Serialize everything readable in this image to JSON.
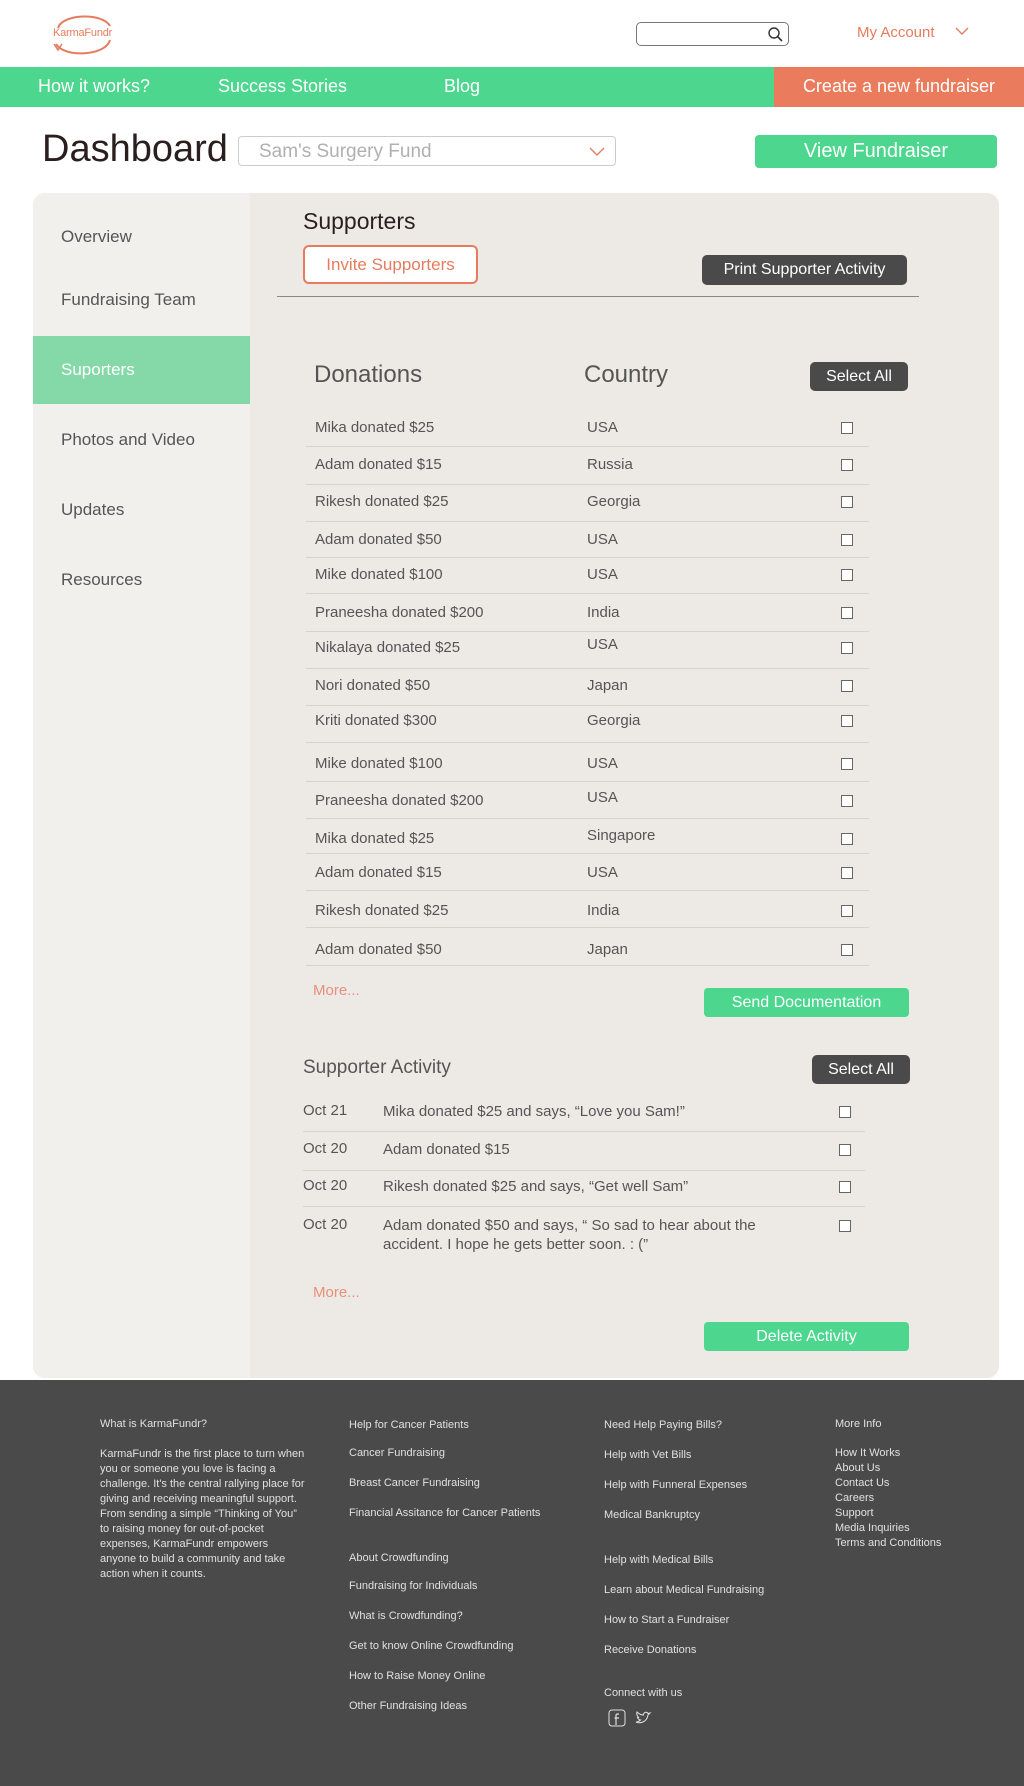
{
  "header": {
    "logo_text": "KarmaFundr",
    "account_label": "My Account"
  },
  "nav": {
    "items": [
      "How it works?",
      "Success Stories",
      "Blog"
    ],
    "create_label": "Create a new fundraiser"
  },
  "dashboard": {
    "title": "Dashboard",
    "selected_fund": "Sam's Surgery Fund",
    "view_label": "View  Fundraiser"
  },
  "sidebar": {
    "items": [
      "Overview",
      "Fundraising Team",
      "Suporters",
      "Photos and Video",
      "Updates",
      "Resources"
    ],
    "active_index": 2
  },
  "supporters": {
    "title": "Supporters",
    "invite_label": "Invite Supporters",
    "print_label": "Print Supporter Activity",
    "col_donations": "Donations",
    "col_country": "Country",
    "select_all_label": "Select All",
    "rows": [
      {
        "donation": "Mika donated $25",
        "country": "USA"
      },
      {
        "donation": "Adam donated $15",
        "country": "Russia"
      },
      {
        "donation": "Rikesh donated $25",
        "country": "Georgia"
      },
      {
        "donation": "Adam donated $50",
        "country": "USA"
      },
      {
        "donation": "Mike donated $100",
        "country": "USA"
      },
      {
        "donation": "Praneesha donated $200",
        "country": "India"
      },
      {
        "donation": "Nikalaya donated $25",
        "country": "USA"
      },
      {
        "donation": "Nori donated $50",
        "country": "Japan"
      },
      {
        "donation": "Kriti donated $300",
        "country": "Georgia"
      },
      {
        "donation": "Mike donated $100",
        "country": "USA"
      },
      {
        "donation": "Praneesha donated $200",
        "country": "USA"
      },
      {
        "donation": "Mika donated $25",
        "country": "Singapore"
      },
      {
        "donation": "Adam donated $15",
        "country": "USA"
      },
      {
        "donation": "Rikesh donated $25",
        "country": "India"
      },
      {
        "donation": "Adam donated $50",
        "country": "Japan"
      }
    ],
    "more_label": "More...",
    "send_label": "Send Documentation"
  },
  "activity": {
    "title": "Supporter Activity",
    "select_all_label": "Select All",
    "rows": [
      {
        "date": "Oct 21",
        "text": "Mika donated $25 and says, “Love you Sam!”"
      },
      {
        "date": "Oct 20",
        "text": "Adam donated $15"
      },
      {
        "date": "Oct 20",
        "text": "Rikesh donated $25 and says, “Get well Sam”"
      },
      {
        "date": "Oct 20",
        "text": "Adam donated $50 and says, “ So sad to hear about the accident. I hope he gets better soon. : (”"
      }
    ],
    "more_label": "More...",
    "delete_label": "Delete Activity"
  },
  "footer": {
    "about_title": "What is KarmaFundr?",
    "about_text": "KarmaFundr is the first place to turn when you or someone you love is facing a challenge. It's the central  rallying place for giving and receiving meaningful support. From sending a simple “Thinking of You” to raising money for out-of-pocket expenses, KarmaFundr empowers anyone to  build a community and take action when it counts.",
    "col2_top": [
      "Help for Cancer Patients",
      "Cancer Fundraising",
      "Breast Cancer Fundraising",
      "Financial Assitance for Cancer Patients"
    ],
    "col2_bottom": [
      "About Crowdfunding",
      "Fundraising for Individuals",
      "What is Crowdfunding?",
      "Get to know Online Crowdfunding",
      "How to Raise Money Online",
      "Other Fundraising Ideas"
    ],
    "col3_top": [
      "Need Help Paying Bills?",
      "Help with Vet Bills",
      "Help with Funneral Expenses",
      "Medical Bankruptcy"
    ],
    "col3_bottom": [
      "Help with Medical Bills",
      "Learn about Medical Fundraising",
      "How to Start a Fundraiser",
      "Receive Donations"
    ],
    "connect_label": "Connect with us",
    "more_info_title": "More Info",
    "more_info": [
      "How It Works",
      "About Us",
      "Contact Us",
      "Careers",
      "Support",
      "Media Inquiries",
      "Terms and Conditions"
    ]
  }
}
